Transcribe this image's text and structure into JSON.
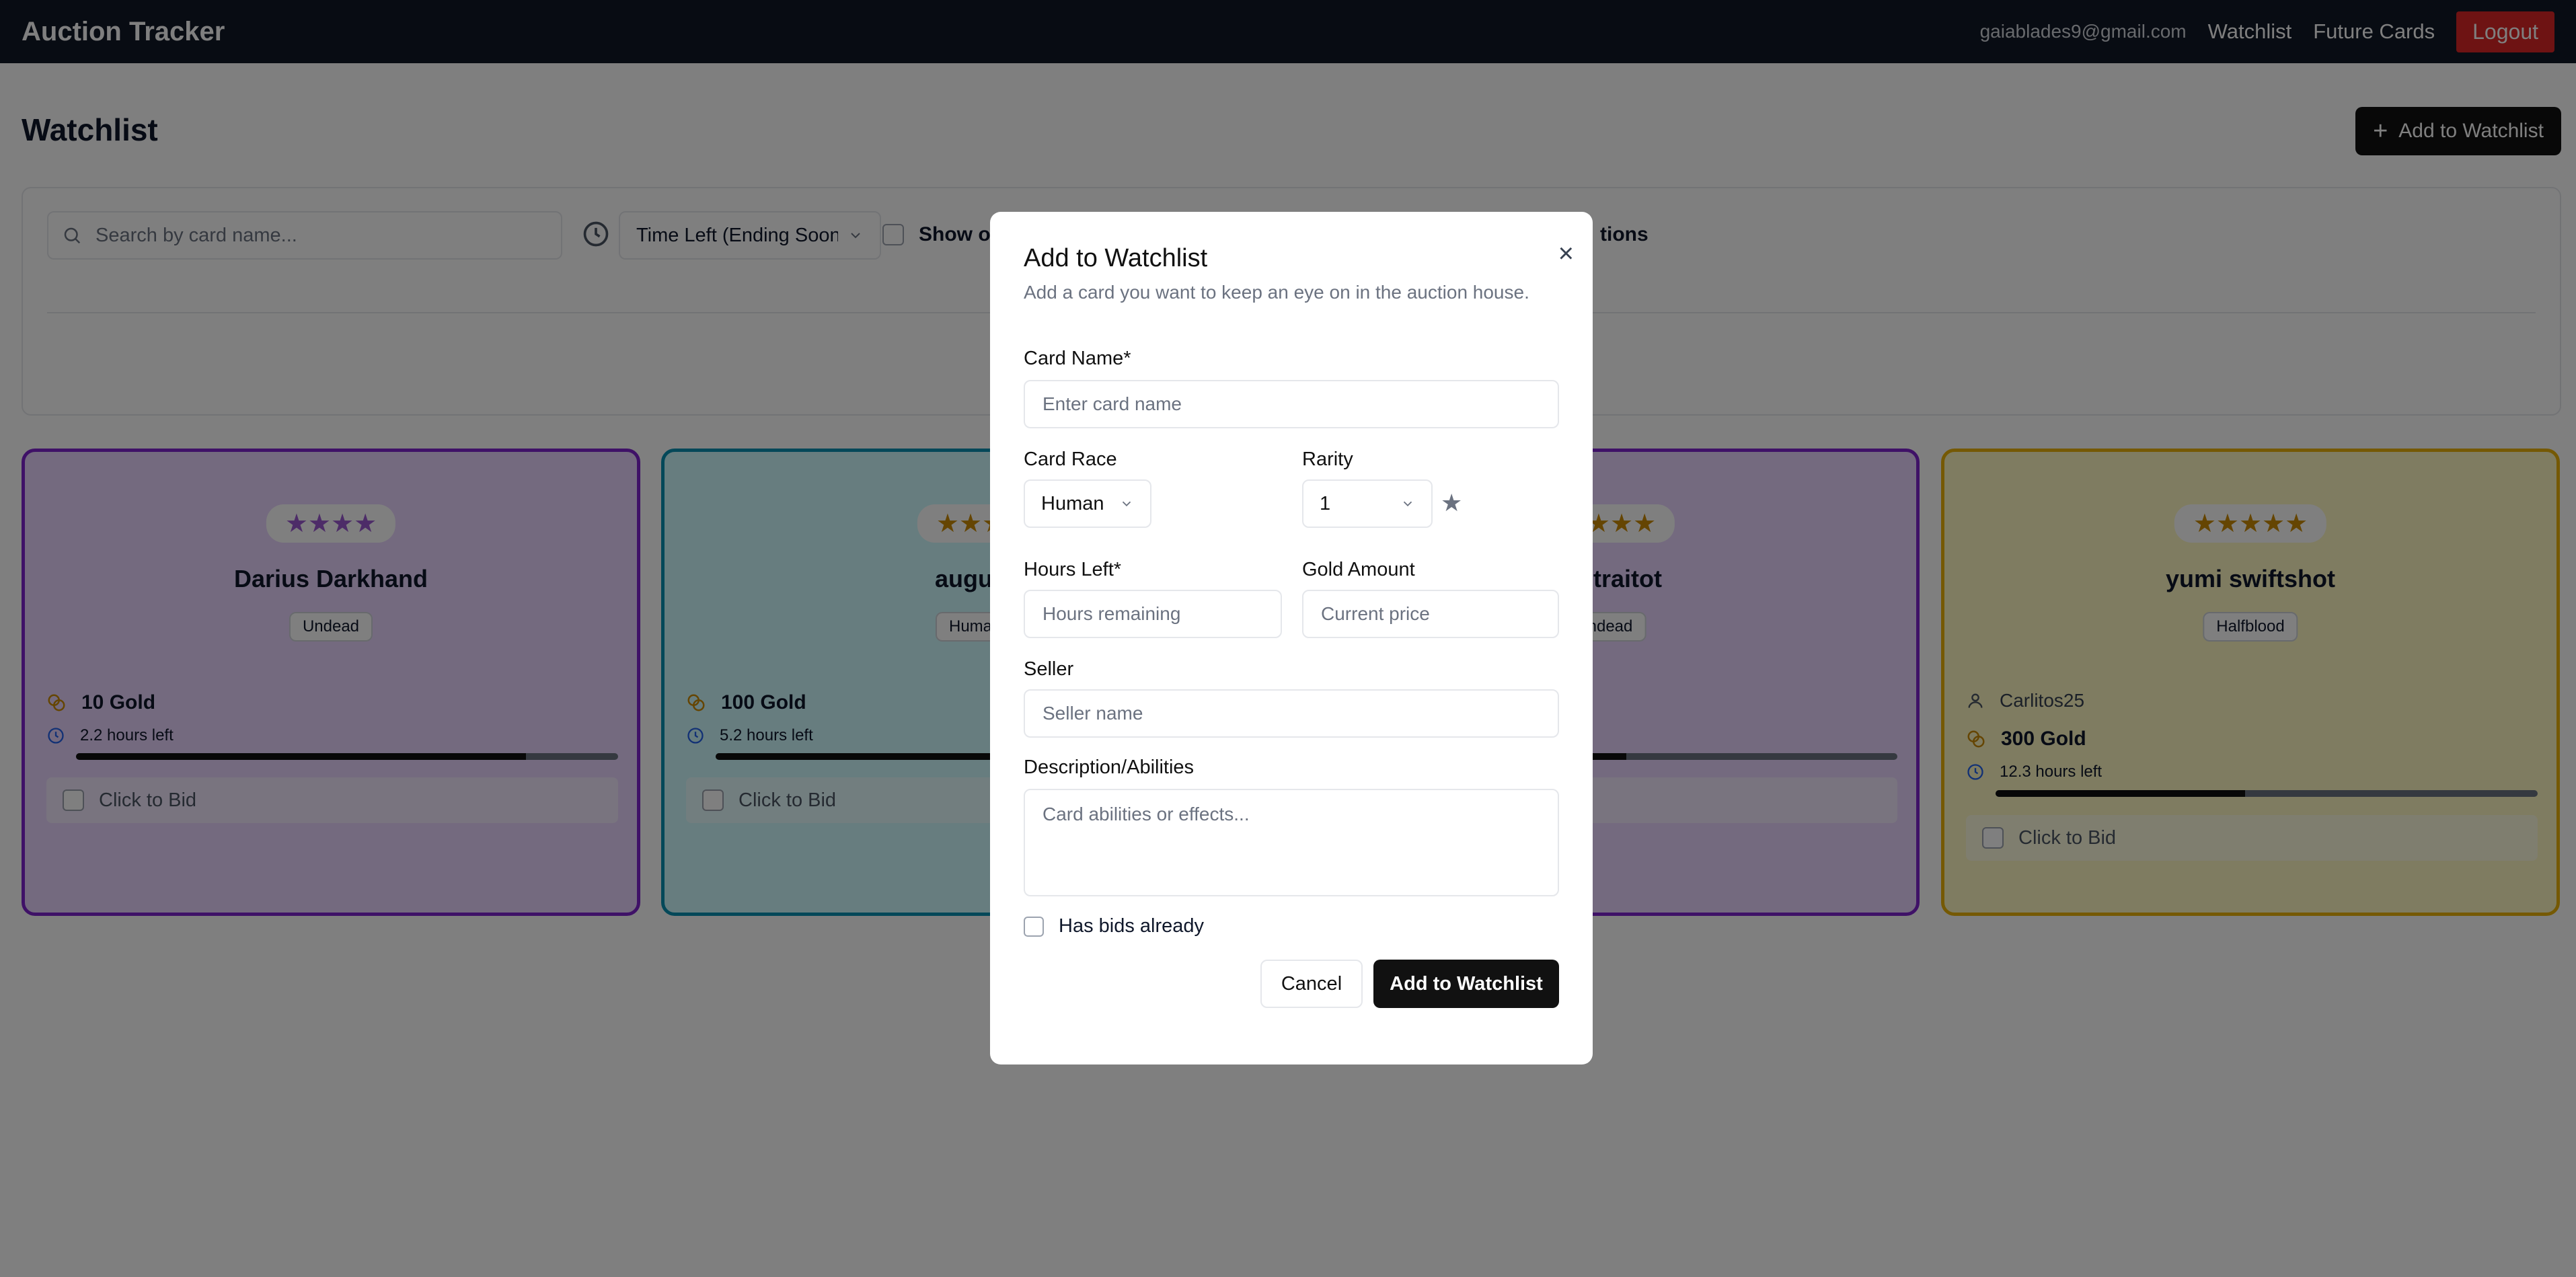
{
  "app": {
    "brand": "Auction Tracker",
    "nav": {
      "email": "gaiablades9@gmail.com",
      "watchlist": "Watchlist",
      "future_cards": "Future Cards",
      "logout": "Logout"
    }
  },
  "page": {
    "title": "Watchlist",
    "add_button": "Add to Watchlist"
  },
  "filters": {
    "search_placeholder": "Search by card name...",
    "sort_value": "Time Left (Ending Soon)",
    "checkbox_label": "Show onl",
    "right_label": "tions"
  },
  "cards": [
    {
      "name": "Darius Darkhand",
      "race": "Undead",
      "stars": "★★★★",
      "gold": "10 Gold",
      "time": "2.2 hours left",
      "progress": 0.83,
      "bid": "Click to Bid",
      "border": "#7e22ce",
      "bg": "#e9d5ff",
      "star_color": "#9b59d0"
    },
    {
      "name": "augus",
      "race": "Huma",
      "stars": "★★★",
      "gold": "100 Gold",
      "time": "5.2 hours left",
      "progress": 0.6,
      "bid": "Click to Bid",
      "border": "#0891b2",
      "bg": "#cffafe",
      "star_color": "#ca8a04"
    },
    {
      "name": "he traitot",
      "race": "ndead",
      "stars": "★★★★",
      "border": "#7e22ce",
      "bg": "#e9d5ff",
      "star_color": "#ca8a04"
    },
    {
      "name": "yumi swiftshot",
      "race": "Halfblood",
      "stars": "★★★★★",
      "seller": "Carlitos25",
      "gold": "300 Gold",
      "time": "12.3 hours left",
      "progress": 0.46,
      "bid": "Click to Bid",
      "border": "#eab308",
      "bg": "#fef9c3",
      "star_color": "#ca8a04"
    }
  ],
  "modal": {
    "title": "Add to Watchlist",
    "subtitle": "Add a card you want to keep an eye on in the auction house.",
    "close": "×",
    "card_name_label": "Card Name*",
    "card_name_placeholder": "Enter card name",
    "card_race_label": "Card Race",
    "card_race_value": "Human",
    "rarity_label": "Rarity",
    "rarity_value": "1",
    "hours_left_label": "Hours Left*",
    "hours_left_placeholder": "Hours remaining",
    "gold_amount_label": "Gold Amount",
    "gold_amount_placeholder": "Current price",
    "seller_label": "Seller",
    "seller_placeholder": "Seller name",
    "description_label": "Description/Abilities",
    "description_placeholder": "Card abilities or effects...",
    "has_bids_label": "Has bids already",
    "cancel_button": "Cancel",
    "submit_button": "Add to Watchlist"
  }
}
